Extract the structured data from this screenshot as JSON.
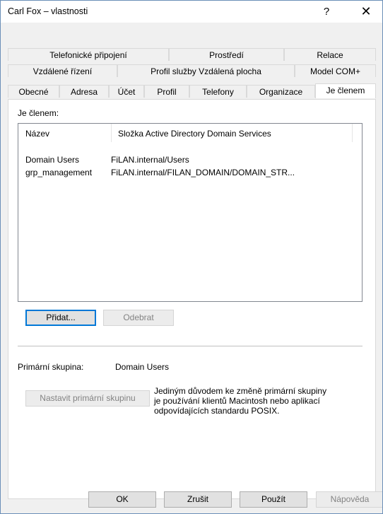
{
  "window": {
    "title": "Carl Fox – vlastnosti",
    "help_glyph": "?",
    "close_glyph": "✕"
  },
  "tabs": {
    "row1": [
      "Telefonické připojení",
      "Prostředí",
      "Relace"
    ],
    "row2": [
      "Vzdálené řízení",
      "Profil služby Vzdálená plocha",
      "Model COM+"
    ],
    "row3": [
      "Obecné",
      "Adresa",
      "Účet",
      "Profil",
      "Telefony",
      "Organizace",
      "Je členem"
    ],
    "active": "Je členem"
  },
  "member_of": {
    "label": "Je členem:",
    "columns": [
      "Název",
      "Složka Active Directory Domain Services"
    ],
    "rows": [
      {
        "name": "Domain Users",
        "folder": "FiLAN.internal/Users"
      },
      {
        "name": "grp_management",
        "folder": "FiLAN.internal/FILAN_DOMAIN/DOMAIN_STR..."
      }
    ],
    "add_label": "Přidat...",
    "remove_label": "Odebrat"
  },
  "primary_group": {
    "label": "Primární skupina:",
    "value": "Domain Users",
    "set_label": "Nastavit primární skupinu",
    "description": [
      "Jediným důvodem ke změně primární skupiny",
      "je používání klientů Macintosh nebo aplikací",
      "odpovídajících standardu POSIX."
    ]
  },
  "footer": {
    "ok": "OK",
    "cancel": "Zrušit",
    "apply": "Použít",
    "help": "Nápověda"
  }
}
